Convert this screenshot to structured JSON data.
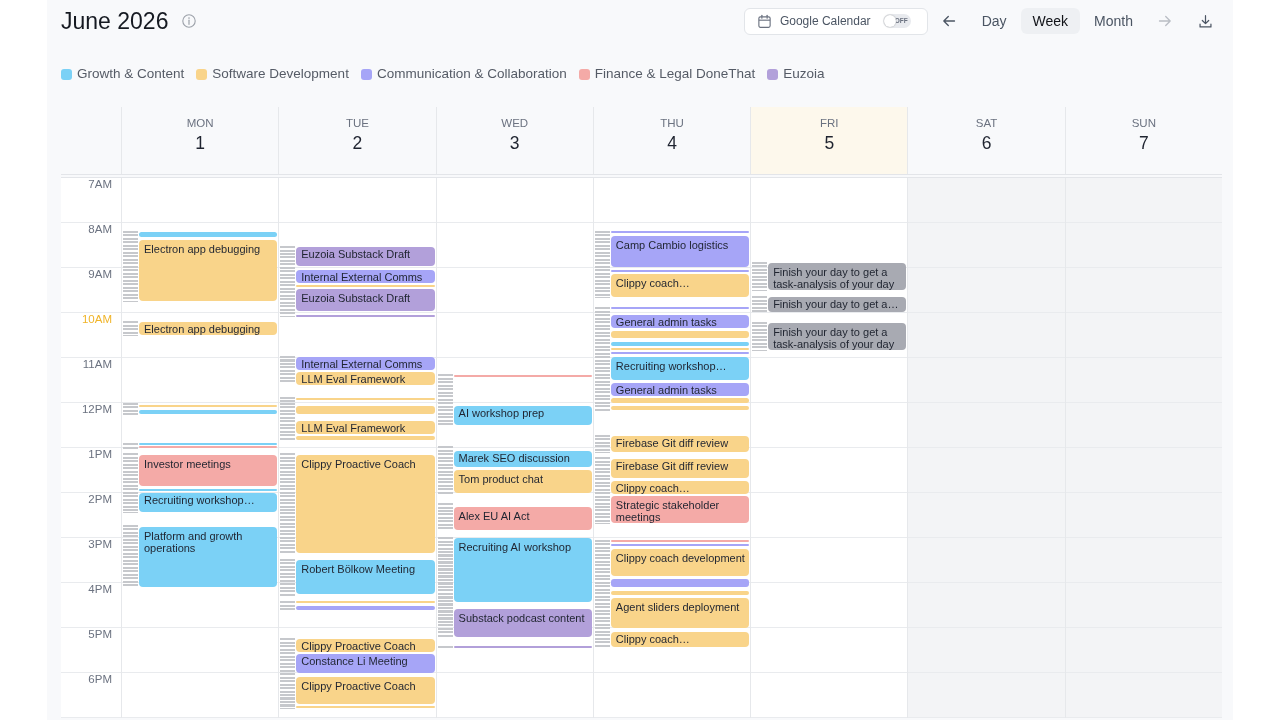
{
  "header": {
    "title": "June 2026",
    "google_calendar": {
      "label": "Google Calendar",
      "on": false,
      "toggle_text": "OFF"
    },
    "navigation": {
      "previous_disabled": false,
      "next_disabled": true
    },
    "views": [
      {
        "label": "Day",
        "selected": false
      },
      {
        "label": "Week",
        "selected": true
      },
      {
        "label": "Month",
        "selected": false
      }
    ]
  },
  "legend": [
    {
      "label": "Growth & Content",
      "color": "#7bd1f6"
    },
    {
      "label": "Software Development",
      "color": "#f9d48a"
    },
    {
      "label": "Communication & Collaboration",
      "color": "#a6a5f7"
    },
    {
      "label": "Finance & Legal DoneThat",
      "color": "#f4aaa7"
    },
    {
      "label": "Euzoia",
      "color": "#b2a0da"
    }
  ],
  "hours": [
    {
      "label": "7AM",
      "current": false
    },
    {
      "label": "8AM",
      "current": false
    },
    {
      "label": "9AM",
      "current": false
    },
    {
      "label": "10AM",
      "current": true
    },
    {
      "label": "11AM",
      "current": false
    },
    {
      "label": "12PM",
      "current": false
    },
    {
      "label": "1PM",
      "current": false
    },
    {
      "label": "2PM",
      "current": false
    },
    {
      "label": "3PM",
      "current": false
    },
    {
      "label": "4PM",
      "current": false
    },
    {
      "label": "5PM",
      "current": false
    },
    {
      "label": "6PM",
      "current": false
    }
  ],
  "days": [
    {
      "weekday": "MON",
      "date": "1",
      "today": false,
      "weekend": false,
      "events": [
        {
          "color": "#7bd1f6"
        },
        {
          "title": "Electron app debugging",
          "color": "#f9d48a"
        },
        {
          "title": "Electron app debugging",
          "color": "#f9d48a"
        },
        {
          "color": "#f9d48a"
        },
        {
          "color": "#7bd1f6"
        },
        {
          "color": "#7bd1f6"
        },
        {
          "color": "#f4aaa7"
        },
        {
          "title": "Investor meetings",
          "color": "#f4aaa7"
        },
        {
          "color": "#7bd1f6"
        },
        {
          "title": "Recruiting workshop…",
          "color": "#7bd1f6"
        },
        {
          "title": "Platform and growth operations",
          "color": "#7bd1f6"
        }
      ]
    },
    {
      "weekday": "TUE",
      "date": "2",
      "today": false,
      "weekend": false,
      "events": [
        {
          "title": "Euzoia Substack Draft",
          "color": "#b2a0da"
        },
        {
          "title": "Internal External Comms",
          "color": "#a6a5f7"
        },
        {
          "color": "#f9d48a"
        },
        {
          "title": "Euzoia Substack Draft",
          "color": "#b2a0da"
        },
        {
          "color": "#b2a0da"
        },
        {
          "title": "Internal External Comms",
          "color": "#a6a5f7"
        },
        {
          "title": "LLM Eval Framework",
          "color": "#f9d48a"
        },
        {
          "color": "#f9d48a"
        },
        {
          "color": "#f9d48a"
        },
        {
          "title": "LLM Eval Framework",
          "color": "#f9d48a"
        },
        {
          "color": "#f9d48a"
        },
        {
          "title": "Clippy Proactive Coach",
          "color": "#f9d48a"
        },
        {
          "title": "Robert Bölkow Meeting",
          "color": "#7bd1f6"
        },
        {
          "color": "#f9d48a"
        },
        {
          "color": "#a6a5f7"
        },
        {
          "title": "Clippy Proactive Coach",
          "color": "#f9d48a"
        },
        {
          "title": "Constance Li Meeting",
          "color": "#a6a5f7"
        },
        {
          "title": "Clippy Proactive Coach",
          "color": "#f9d48a"
        },
        {
          "color": "#f9d48a"
        }
      ]
    },
    {
      "weekday": "WED",
      "date": "3",
      "today": false,
      "weekend": false,
      "events": [
        {
          "color": "#f4aaa7"
        },
        {
          "title": "AI workshop prep",
          "color": "#7bd1f6"
        },
        {
          "title": "Marek SEO discussion",
          "color": "#7bd1f6"
        },
        {
          "title": "Tom product chat",
          "color": "#f9d48a"
        },
        {
          "title": "Alex EU AI Act",
          "color": "#f4aaa7"
        },
        {
          "title": "Recruiting AI workshop",
          "color": "#7bd1f6"
        },
        {
          "title": "Substack podcast content",
          "color": "#b2a0da"
        },
        {
          "color": "#b2a0da"
        }
      ]
    },
    {
      "weekday": "THU",
      "date": "4",
      "today": false,
      "weekend": false,
      "events": [
        {
          "color": "#a6a5f7"
        },
        {
          "title": "Camp Cambio logistics",
          "color": "#a6a5f7"
        },
        {
          "color": "#a6a5f7"
        },
        {
          "title": "Clippy coach…",
          "color": "#f9d48a"
        },
        {
          "color": "#a6a5f7"
        },
        {
          "title": "General admin tasks",
          "color": "#a6a5f7"
        },
        {
          "color": "#f9d48a"
        },
        {
          "color": "#7bd1f6"
        },
        {
          "color": "#f9d48a"
        },
        {
          "color": "#a6a5f7"
        },
        {
          "title": "Recruiting workshop…",
          "color": "#7bd1f6"
        },
        {
          "title": "General admin tasks",
          "color": "#a6a5f7"
        },
        {
          "color": "#f9d48a"
        },
        {
          "color": "#f9d48a"
        },
        {
          "title": "Firebase Git diff review",
          "color": "#f9d48a"
        },
        {
          "title": "Firebase Git diff review",
          "color": "#f9d48a"
        },
        {
          "title": "Clippy coach…",
          "color": "#f9d48a"
        },
        {
          "title": "Strategic stakeholder meetings",
          "color": "#f4aaa7"
        },
        {
          "color": "#f4aaa7"
        },
        {
          "color": "#a6a5f7"
        },
        {
          "title": "Clippy coach development",
          "color": "#f9d48a"
        },
        {
          "color": "#a6a5f7"
        },
        {
          "color": "#f9d48a"
        },
        {
          "title": "Agent sliders deployment",
          "color": "#f9d48a"
        },
        {
          "title": "Clippy coach…",
          "color": "#f9d48a"
        }
      ]
    },
    {
      "weekday": "FRI",
      "date": "5",
      "today": true,
      "weekend": false,
      "events": [
        {
          "title": "Finish your day to get a task-analysis of your day",
          "color": "#a8aab2"
        },
        {
          "title": "Finish your day to get a…",
          "color": "#a8aab2"
        },
        {
          "title": "Finish your day to get a task-analysis of your day",
          "color": "#a8aab2"
        }
      ]
    },
    {
      "weekday": "SAT",
      "date": "6",
      "today": false,
      "weekend": true
    },
    {
      "weekday": "SUN",
      "date": "7",
      "today": false,
      "weekend": true
    }
  ]
}
